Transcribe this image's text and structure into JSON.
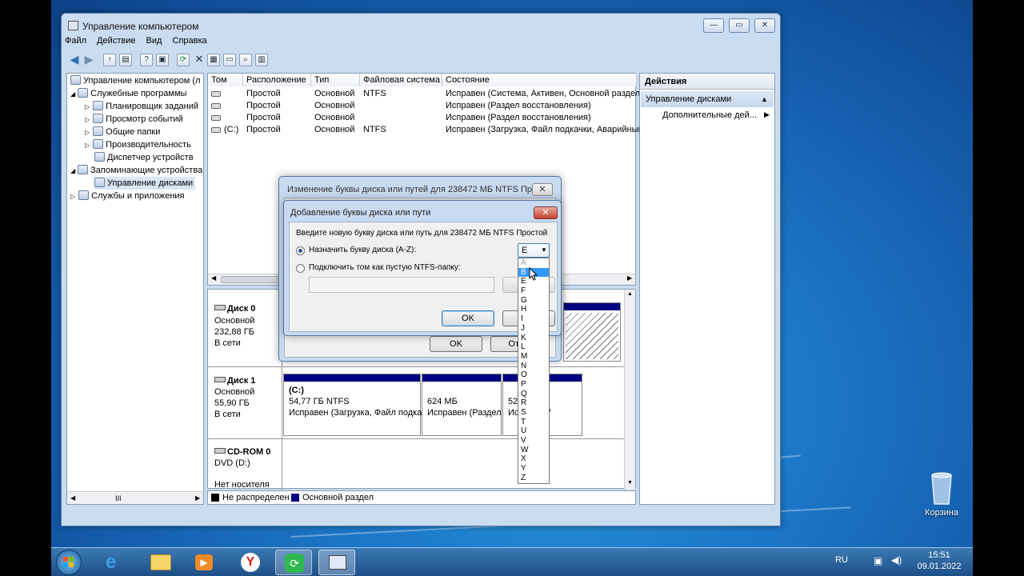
{
  "window": {
    "title": "Управление компьютером"
  },
  "menu": [
    "Файл",
    "Действие",
    "Вид",
    "Справка"
  ],
  "tree": {
    "root": "Управление компьютером (л",
    "items": [
      "Служебные программы",
      "Планировщик заданий",
      "Просмотр событий",
      "Общие папки",
      "Производительность",
      "Диспетчер устройств",
      "Запоминающие устройства",
      "Управление дисками",
      "Службы и приложения"
    ]
  },
  "volumes": {
    "columns": [
      "Том",
      "Расположение",
      "Тип",
      "Файловая система",
      "Состояние"
    ],
    "rows": [
      {
        "vol": "",
        "loc": "Простой",
        "type": "Основной",
        "fs": "NTFS",
        "status": "Исправен (Система, Активен, Основной раздел)"
      },
      {
        "vol": "",
        "loc": "Простой",
        "type": "Основной",
        "fs": "",
        "status": "Исправен (Раздел восстановления)"
      },
      {
        "vol": "",
        "loc": "Простой",
        "type": "Основной",
        "fs": "",
        "status": "Исправен (Раздел восстановления)"
      },
      {
        "vol": "(C:)",
        "loc": "Простой",
        "type": "Основной",
        "fs": "NTFS",
        "status": "Исправен (Загрузка, Файл подкачки, Аварийный"
      }
    ]
  },
  "actions": {
    "header": "Действия",
    "section": "Управление дисками",
    "item": "Дополнительные дей..."
  },
  "disks": {
    "disk0": {
      "name": "Диск 0",
      "type": "Основной",
      "size": "232,88 ГБ",
      "status": "В сети"
    },
    "disk1": {
      "name": "Диск 1",
      "type": "Основной",
      "size": "55,90 ГБ",
      "status": "В сети",
      "partitions": [
        {
          "label": "(C:)",
          "size": "54,77 ГБ NTFS",
          "status": "Исправен (Загрузка, Файл подка"
        },
        {
          "label": "",
          "size": "624 МБ",
          "status": "Исправен (Раздел"
        },
        {
          "label": "",
          "size": "52(",
          "status": "Ис( Разде/"
        }
      ]
    },
    "cdrom": {
      "name": "CD-ROM 0",
      "type": "DVD (D:)",
      "status": "Нет носителя"
    }
  },
  "legend": [
    "Не распределен",
    "Основной раздел"
  ],
  "scrollbar_label": "III",
  "dialog_back": {
    "title": "Изменение буквы диска или путей для 238472 МБ NTFS Пр...",
    "ok": "OK",
    "cancel": "Отм"
  },
  "dialog_front": {
    "title": "Добавление буквы диска или пути",
    "prompt": "Введите новую букву диска или путь для 238472 МБ NTFS Простой",
    "option1": "Назначить букву диска (A-Z):",
    "option2": "Подключить том как пустую NTFS-папку:",
    "browse": "Обз",
    "ok": "OK",
    "cancel": "От",
    "selected_letter": "E"
  },
  "letters": [
    "A",
    "B",
    "E",
    "F",
    "G",
    "H",
    "I",
    "J",
    "K",
    "L",
    "M",
    "N",
    "O",
    "P",
    "Q",
    "R",
    "S",
    "T",
    "U",
    "V",
    "W",
    "X",
    "Y",
    "Z"
  ],
  "desktop": {
    "recycle": "Корзина"
  },
  "tray": {
    "lang": "RU",
    "time": "15:51",
    "date": "09.01.2022"
  },
  "colors": {
    "primary_partition": "#000080",
    "highlight": "#3399ff"
  }
}
